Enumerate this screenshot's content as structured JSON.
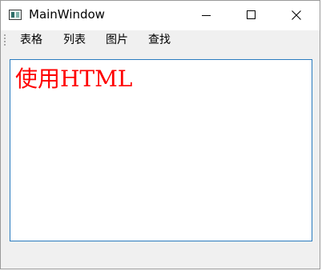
{
  "window": {
    "title": "MainWindow",
    "app_icon": "window-app-icon",
    "minimize_icon": "minimize-icon",
    "maximize_icon": "maximize-icon",
    "close_icon": "close-icon"
  },
  "menubar": {
    "grip_icon": "toolbar-grip-icon",
    "items": [
      {
        "label": "表格"
      },
      {
        "label": "列表"
      },
      {
        "label": "图片"
      },
      {
        "label": "查找"
      }
    ]
  },
  "editor": {
    "text": "使用HTML",
    "text_color": "#ff0000",
    "border_color": "#2a7bbf"
  }
}
